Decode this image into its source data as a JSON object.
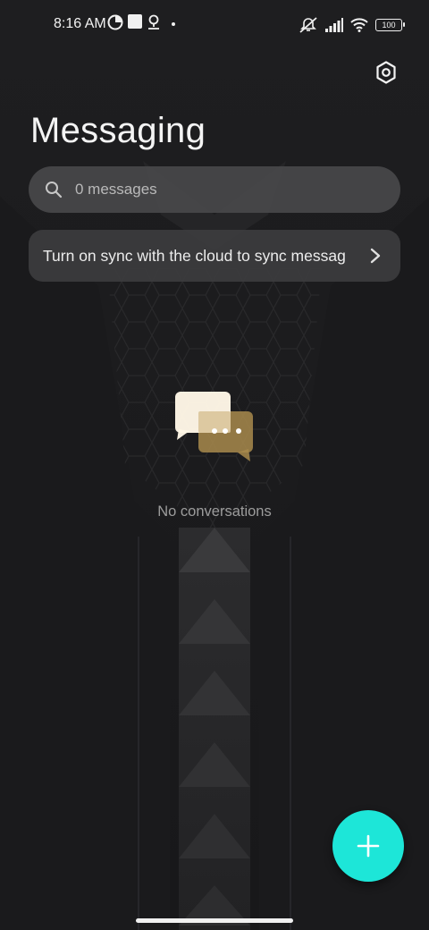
{
  "status_bar": {
    "time": "8:16 AM",
    "battery": "100",
    "icons": [
      "data-saver-icon",
      "square-notification-icon",
      "location-pin-icon",
      "dot-icon",
      "mute-icon",
      "signal-icon",
      "wifi-icon",
      "battery-icon"
    ]
  },
  "header": {
    "title": "Messaging",
    "settings_icon": "gear-icon"
  },
  "search": {
    "placeholder": "0 messages",
    "icon": "search-icon"
  },
  "sync_banner": {
    "text": "Turn on sync with the cloud to sync messag",
    "icon": "chevron-right-icon"
  },
  "empty_state": {
    "icon": "chat-bubbles-icon",
    "text": "No conversations"
  },
  "fab": {
    "icon": "plus-icon",
    "color": "#1de6d8"
  },
  "colors": {
    "background": "#1b1b1d",
    "accent": "#1de6d8",
    "bubble_front": "#fff7e6",
    "bubble_back": "#a88a4c"
  }
}
